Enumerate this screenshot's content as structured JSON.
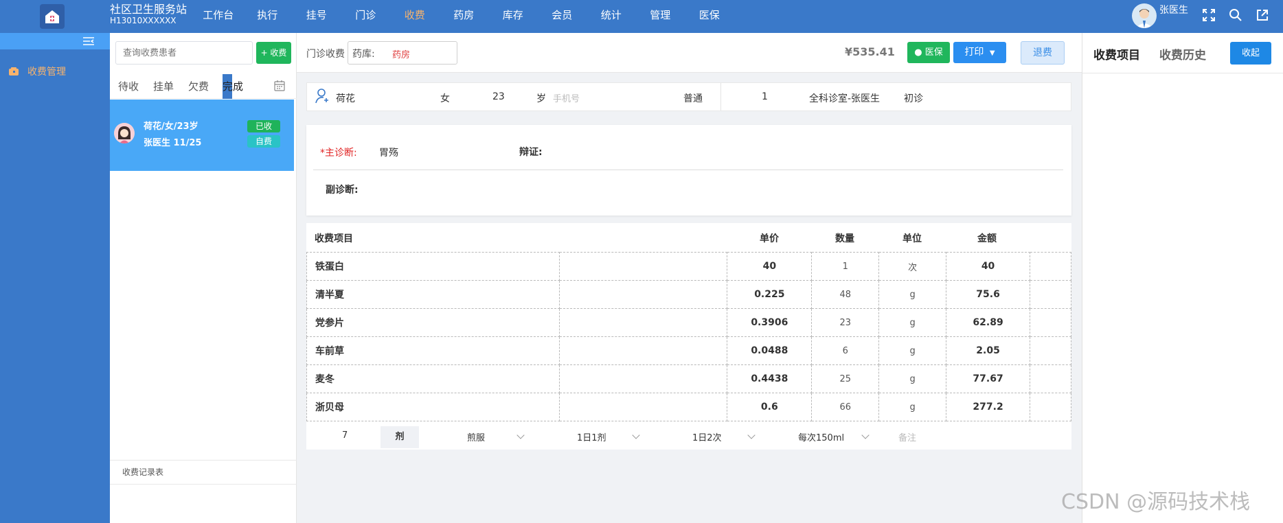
{
  "app": {
    "name": "社区卫生服务站",
    "code": "H13010XXXXXX"
  },
  "nav": [
    "工作台",
    "执行",
    "挂号",
    "门诊",
    "收费",
    "药房",
    "库存",
    "会员",
    "统计",
    "管理",
    "医保"
  ],
  "nav_active": "收费",
  "user": {
    "name": "张医生"
  },
  "sidebar": {
    "items": [
      {
        "label": "收费管理",
        "icon": "wallet-icon"
      }
    ]
  },
  "patient_list": {
    "search_placeholder": "查询收费患者",
    "charge_button": "+ 收费",
    "tabs": [
      "待收",
      "挂单",
      "欠费",
      "完成"
    ],
    "active_tab": "完成",
    "card": {
      "line1": "荷花/女/23岁",
      "line2": "张医生   11/25",
      "status": "已收",
      "payment": "自费"
    },
    "records_header": "收费记录表"
  },
  "header": {
    "label": "门诊收费",
    "pharmacy_label": "药库:",
    "pharmacy_value": "药房",
    "total": "¥535.41",
    "insurance_button": "医保",
    "print_button": "打印",
    "refund_button": "退费"
  },
  "patient": {
    "name": "荷花",
    "gender": "女",
    "age": "23",
    "age_unit": "岁",
    "phone_placeholder": "手机号",
    "visit_type": "普通",
    "visit_no": "1",
    "department": "全科诊室-张医生",
    "visit_kind": "初诊"
  },
  "diagnosis": {
    "main_label": "*主诊断:",
    "main_value": "胃殇",
    "syndrome_label": "辩证:",
    "secondary_label": "副诊断:"
  },
  "fees": {
    "headers": {
      "item": "收费项目",
      "price": "单价",
      "qty": "数量",
      "unit": "单位",
      "amount": "金额"
    },
    "rows": [
      {
        "name": "铁蛋白",
        "price": "40",
        "qty": "1",
        "unit": "次",
        "amount": "40"
      },
      {
        "name": "清半夏",
        "price": "0.225",
        "qty": "48",
        "unit": "g",
        "amount": "75.6"
      },
      {
        "name": "党参片",
        "price": "0.3906",
        "qty": "23",
        "unit": "g",
        "amount": "62.89"
      },
      {
        "name": "车前草",
        "price": "0.0488",
        "qty": "6",
        "unit": "g",
        "amount": "2.05"
      },
      {
        "name": "麦冬",
        "price": "0.4438",
        "qty": "25",
        "unit": "g",
        "amount": "77.67"
      },
      {
        "name": "浙贝母",
        "price": "0.6",
        "qty": "66",
        "unit": "g",
        "amount": "277.2"
      }
    ],
    "footer": {
      "dose_count": "7",
      "dose_unit": "剂",
      "usage": "煎服",
      "frequency_day": "1日1剂",
      "frequency_times": "1日2次",
      "per_dose": "每次150ml",
      "note_placeholder": "备注"
    }
  },
  "right_panel": {
    "tab1": "收费项目",
    "tab2": "收费历史",
    "collapse_button": "收起"
  },
  "watermark": "CSDN @源码技术栈",
  "colors": {
    "topbar": "#3a79c9",
    "accent": "#f7b36d",
    "card": "#49a8f7",
    "green": "#20b65c",
    "blue": "#2b8ef0"
  }
}
